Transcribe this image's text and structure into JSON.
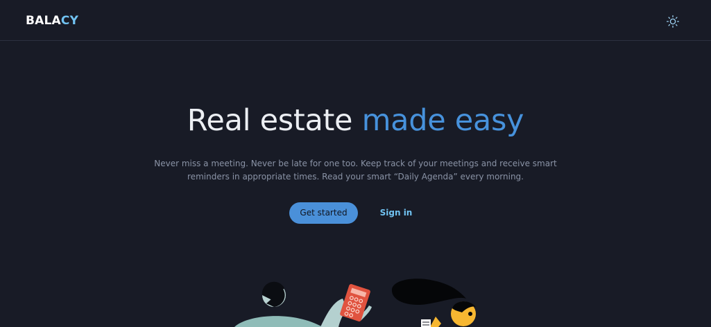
{
  "brand": {
    "logo_part1": "BALA",
    "logo_part2": "CY",
    "logo_color_primary": "#ffffff",
    "logo_color_accent": "#71c3f2"
  },
  "header": {
    "theme_toggle_icon": "sun-icon"
  },
  "hero": {
    "title_plain": "Real estate ",
    "title_accent": "made easy",
    "description": "Never miss a meeting. Never be late for one too. Keep track of your meetings and receive smart reminders in appropriate times. Read your smart “Daily Agenda” every morning.",
    "primary_button": "Get started",
    "secondary_link": "Sign in"
  },
  "colors": {
    "background": "#181b26",
    "accent": "#4a90d9",
    "link": "#71c3f2",
    "muted_text": "#8a93a6"
  }
}
